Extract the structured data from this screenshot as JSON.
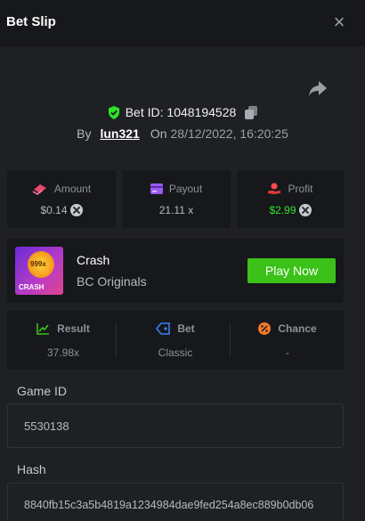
{
  "header": {
    "title": "Bet Slip",
    "close_glyph": "×"
  },
  "bet": {
    "id_label": "Bet ID: 1048194528",
    "by_label": "By",
    "username": "lun321",
    "on_label": "On",
    "date": "28/12/2022, 16:20:25"
  },
  "stats": {
    "amount": {
      "label": "Amount",
      "value": "$0.14",
      "icon": "amount-icon"
    },
    "payout": {
      "label": "Payout",
      "value": "21.11 x",
      "icon": "payout-icon"
    },
    "profit": {
      "label": "Profit",
      "value": "$2.99",
      "icon": "profit-icon"
    }
  },
  "game": {
    "name": "Crash",
    "provider": "BC Originals",
    "play_label": "Play Now",
    "thumb_multiplier": "999x",
    "thumb_title": "CRASH"
  },
  "info": {
    "result": {
      "label": "Result",
      "value": "37.98x"
    },
    "bet": {
      "label": "Bet",
      "value": "Classic"
    },
    "chance": {
      "label": "Chance",
      "value": "-"
    }
  },
  "fields": {
    "game_id_label": "Game ID",
    "game_id_value": "5530138",
    "hash_label": "Hash",
    "hash_value": "8840fb15c3a5b4819a1234984dae9fed254a8ec889b0db06"
  },
  "colors": {
    "accent_green": "#3bc117",
    "profit_green": "#2ee22b",
    "panel": "#17181b",
    "background": "#1e2023"
  }
}
